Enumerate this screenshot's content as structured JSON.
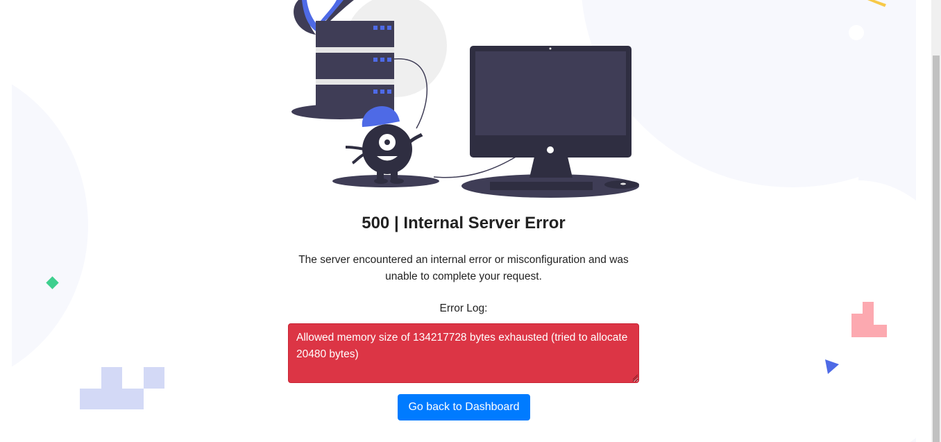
{
  "error": {
    "title": "500 | Internal Server Error",
    "message": "The server encountered an internal error or misconfiguration and was unable to complete your request.",
    "log_label": "Error Log:",
    "log_text": "Allowed memory size of 134217728 bytes exhausted (tried to allocate 20480 bytes)"
  },
  "actions": {
    "back_label": "Go back to Dashboard"
  },
  "colors": {
    "danger": "#dc3545",
    "primary": "#007bff",
    "illustration_dark": "#3f3d56",
    "illustration_accent": "#4e6ae6"
  },
  "icons": {
    "illustration": "server-error-illustration",
    "decorations": [
      "green-diamond",
      "blue-triangle",
      "pink-steps",
      "lavender-blocks",
      "yellow-bar",
      "white-dot"
    ]
  }
}
